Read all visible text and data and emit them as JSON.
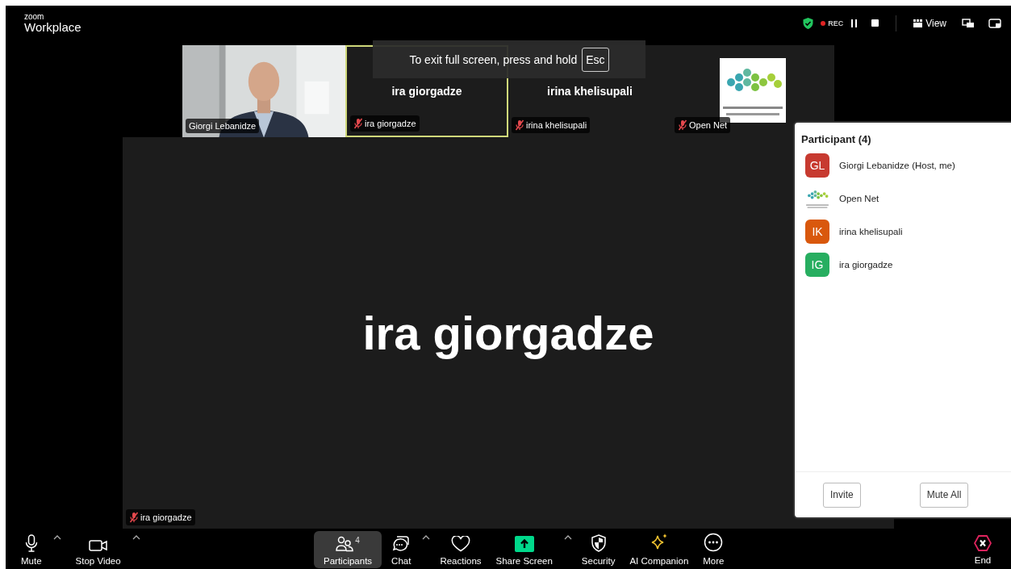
{
  "app": {
    "logo_top": "zoom",
    "logo_bottom": "Workplace"
  },
  "top_bar": {
    "recording": "REC",
    "view": "View"
  },
  "toast": {
    "text": "To exit full screen, press and hold",
    "key": "Esc"
  },
  "tiles": [
    {
      "kind": "video",
      "name": "Giorgi Lebanidze",
      "muted": false,
      "speaking": false
    },
    {
      "kind": "name",
      "title": "ira giorgadze",
      "name": "ira giorgadze",
      "muted": true,
      "speaking": true
    },
    {
      "kind": "name",
      "title": "irina khelisupali",
      "name": "irina khelisupali",
      "muted": true,
      "speaking": false
    },
    {
      "kind": "logo",
      "name": "Open Net",
      "muted": true,
      "speaking": false
    }
  ],
  "stage": {
    "title": "ira giorgadze",
    "name": "ira giorgadze",
    "muted": true
  },
  "participants_panel": {
    "title": "Participant (4)",
    "participants": [
      {
        "kind": "initials",
        "initials": "GL",
        "color": "#c73a30",
        "name": "Giorgi Lebanidze (Host, me)"
      },
      {
        "kind": "picture",
        "name": "Open Net"
      },
      {
        "kind": "initials",
        "initials": "IK",
        "color": "#d9580d",
        "name": "irina khelisupali"
      },
      {
        "kind": "initials",
        "initials": "IG",
        "color": "#27ae60",
        "name": "ira giorgadze"
      }
    ],
    "buttons": [
      "Invite",
      "Mute All"
    ]
  },
  "toolbar": {
    "left": [
      {
        "kind": "mic",
        "label": "Mute",
        "caret": true,
        "selected": false
      },
      {
        "kind": "camera",
        "label": "Stop Video",
        "caret": true,
        "selected": false
      }
    ],
    "center": [
      {
        "kind": "people",
        "label": "Participants",
        "badge": "4",
        "caret": false,
        "selected": true
      },
      {
        "kind": "chat",
        "label": "Chat",
        "caret": true,
        "selected": false
      },
      {
        "kind": "heart",
        "label": "Reactions",
        "caret": false,
        "selected": false
      },
      {
        "kind": "share",
        "label": "Share Screen",
        "caret": true,
        "selected": false
      },
      {
        "kind": "shield",
        "label": "Security",
        "caret": false,
        "selected": false
      },
      {
        "kind": "sparkle",
        "label": "AI Companion",
        "caret": false,
        "selected": false
      },
      {
        "kind": "more",
        "label": "More",
        "caret": false,
        "selected": false
      }
    ],
    "end": {
      "label": "End"
    }
  }
}
